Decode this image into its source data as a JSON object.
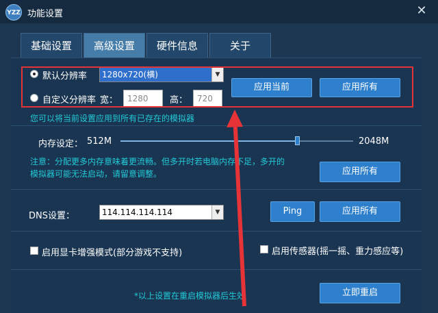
{
  "window": {
    "logo": "YZZ",
    "title": "功能设置",
    "close": "✕"
  },
  "tabs": [
    {
      "label": "基础设置",
      "active": false
    },
    {
      "label": "高级设置",
      "active": true
    },
    {
      "label": "硬件信息",
      "active": false
    },
    {
      "label": "关于",
      "active": false
    }
  ],
  "resolution": {
    "default_label": "默认分辨率",
    "default_value": "1280x720(横)",
    "custom_label": "自定义分辨率",
    "width_label": "宽：",
    "width_value": "1280",
    "height_label": "高：",
    "height_value": "720",
    "apply_current": "应用当前",
    "apply_all": "应用所有",
    "hint": "您可以将当前设置应用到所有已存在的模拟器",
    "selected": "default"
  },
  "memory": {
    "label": "内存设定：",
    "min": "512M",
    "max": "2048M",
    "level_fraction": 0.76,
    "note_line1": "注意：分配更多内存意味着更流畅。但多开时若电脑内存不足，多开的",
    "note_line2": "模拟器可能无法启动，请留意调整。",
    "apply_all": "应用所有"
  },
  "dns": {
    "label": "DNS设置：",
    "value": "114.114.114.114",
    "ping": "Ping",
    "apply_all": "应用所有"
  },
  "options": {
    "gpu_label": "启用显卡增强模式(部分游戏不支持)",
    "gpu_checked": false,
    "sensor_label": "启用传感器(摇一摇、重力感应等)",
    "sensor_checked": false
  },
  "footer": {
    "note": "*以上设置在重启模拟器后生效",
    "restart": "立即重启"
  },
  "colors": {
    "accent_blue": "#2e7fcc",
    "highlight_red": "#e53337",
    "hint_cyan": "#22c9d6"
  }
}
